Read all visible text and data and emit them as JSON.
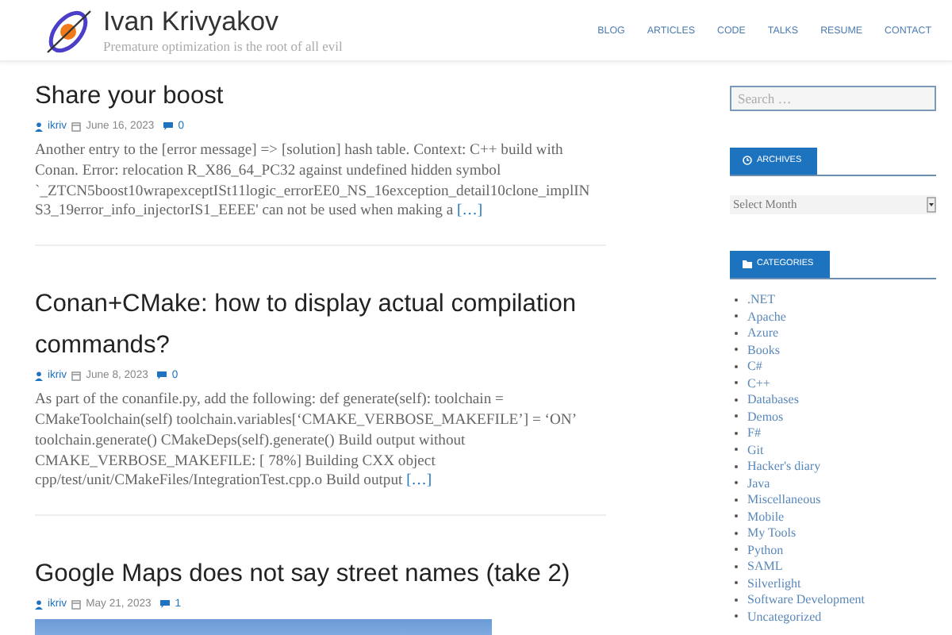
{
  "site": {
    "title": "Ivan Krivyakov",
    "tagline": "Premature optimization is the root of all evil"
  },
  "nav": [
    "BLOG",
    "ARTICLES",
    "CODE",
    "TALKS",
    "RESUME",
    "CONTACT"
  ],
  "posts": [
    {
      "title": "Share your boost",
      "author": "ikriv",
      "date": "June 16, 2023",
      "comments": "0",
      "excerpt": "Another entry to the [error message] => [solution] hash table. Context: C++ build with Conan. Error: relocation R_X86_64_PC32 against undefined hidden symbol `_ZTCN5boost10wrapexceptISt11logic_errorEE0_NS_16exception_detail10clone_implIN S3_19error_info_injectorIS1_EEEE' can not be used when making a",
      "more": "[…]"
    },
    {
      "title": "Conan+CMake: how to display actual compilation commands?",
      "author": "ikriv",
      "date": "June 8, 2023",
      "comments": "0",
      "excerpt": "As part of the conanfile.py, add the following: def generate(self): toolchain = CMakeToolchain(self) toolchain.variables[‘CMAKE_VERBOSE_MAKEFILE’] = ‘ON’ toolchain.generate() CMakeDeps(self).generate() Build output without CMAKE_VERBOSE_MAKEFILE: [ 78%] Building CXX object cpp/test/unit/CMakeFiles/IntegrationTest.cpp.o Build output",
      "more": "[…]"
    },
    {
      "title": "Google Maps does not say street names (take 2)",
      "author": "ikriv",
      "date": "May 21, 2023",
      "comments": "1",
      "image": true
    }
  ],
  "sidebar": {
    "search": {
      "placeholder": "Search …"
    },
    "archives": {
      "heading": "ARCHIVES",
      "select": "Select Month"
    },
    "categories": {
      "heading": "CATEGORIES",
      "items": [
        ".NET",
        "Apache",
        "Azure",
        "Books",
        "C#",
        "C++",
        "Databases",
        "Demos",
        "F#",
        "Git",
        "Hacker's diary",
        "Java",
        "Miscellaneous",
        "Mobile",
        "My Tools",
        "Python",
        "SAML",
        "Silverlight",
        "Software Development",
        "Uncategorized"
      ]
    }
  }
}
